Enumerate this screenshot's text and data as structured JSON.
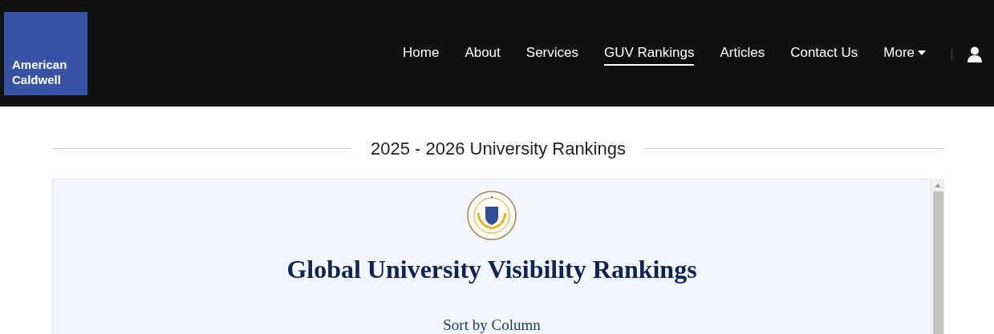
{
  "logo": {
    "lines": [
      "American",
      "Caldwell"
    ]
  },
  "nav": [
    {
      "label": "Home",
      "selected": false
    },
    {
      "label": "About",
      "selected": false
    },
    {
      "label": "Services",
      "selected": false
    },
    {
      "label": "GUV Rankings",
      "selected": true
    },
    {
      "label": "Articles",
      "selected": false
    },
    {
      "label": "Contact Us",
      "selected": false
    },
    {
      "label": "More",
      "selected": false,
      "kind": "dropdown"
    }
  ],
  "section_title": "2025 - 2026 University Rankings",
  "panel": {
    "title": "Global University Visibility Rankings",
    "sort_label": "Sort by Column"
  }
}
